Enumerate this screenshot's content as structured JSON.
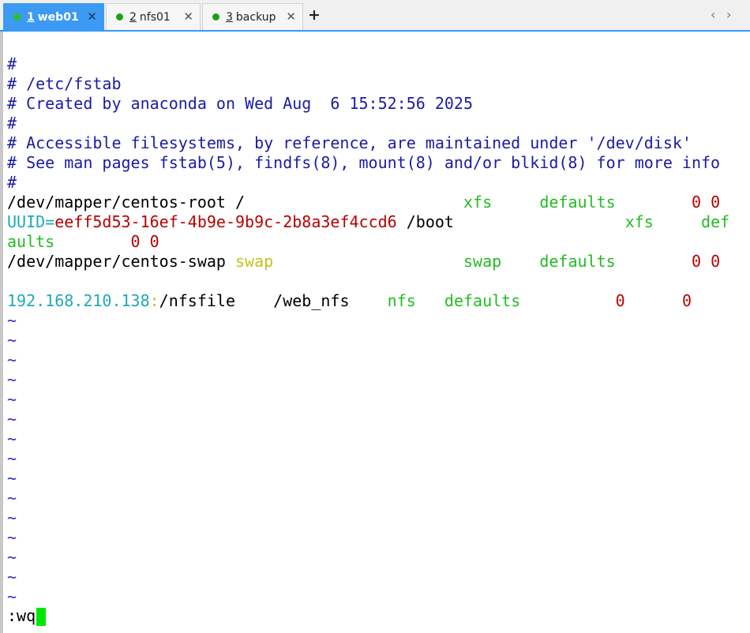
{
  "tabs": [
    {
      "num": "1",
      "label": "web01",
      "close": "✕"
    },
    {
      "num": "2",
      "label": "nfs01",
      "close": "✕"
    },
    {
      "num": "3",
      "label": "backup",
      "close": "✕"
    }
  ],
  "tabbar": {
    "add": "+",
    "prev": "‹",
    "next": "›"
  },
  "terminal": {
    "comments": [
      "#",
      "# /etc/fstab",
      "# Created by anaconda on Wed Aug  6 15:52:56 2025",
      "#",
      "# Accessible filesystems, by reference, are maintained under '/dev/disk'",
      "# See man pages fstab(5), findfs(8), mount(8) and/or blkid(8) for more info",
      "#"
    ],
    "root_line": {
      "device": "/dev/mapper/centos-root /",
      "type": "xfs",
      "options": "defaults",
      "nums": "0 0"
    },
    "boot_line": {
      "key": "UUID=",
      "uuid": "eeff5d53-16ef-4b9e-9b9c-2b8a3ef4ccd6",
      "mount": " /boot",
      "type": "xfs",
      "options_start": "def",
      "options_end": "aults",
      "nums": "0 0"
    },
    "swap_line": {
      "device": "/dev/mapper/centos-swap",
      "mount": "swap",
      "type": "swap",
      "options": "defaults",
      "nums": "0 0"
    },
    "nfs_line": {
      "host": "192.168.210.138",
      "sep": ":",
      "path": "/nfsfile",
      "mount": "/web_nfs",
      "type": "nfs",
      "options": "defaults",
      "dump": "0",
      "pass": "0"
    },
    "tilde": "~",
    "tilde_count": 15,
    "command": ":wq"
  },
  "colors": {
    "comment": "#1b1ba8",
    "keyword": "#22bb22",
    "number": "#b80000",
    "uuid_key": "#1fa9b8",
    "swap_word": "#c2c21a",
    "cursor": "#00e600",
    "tab_active": "#3c9af3"
  }
}
